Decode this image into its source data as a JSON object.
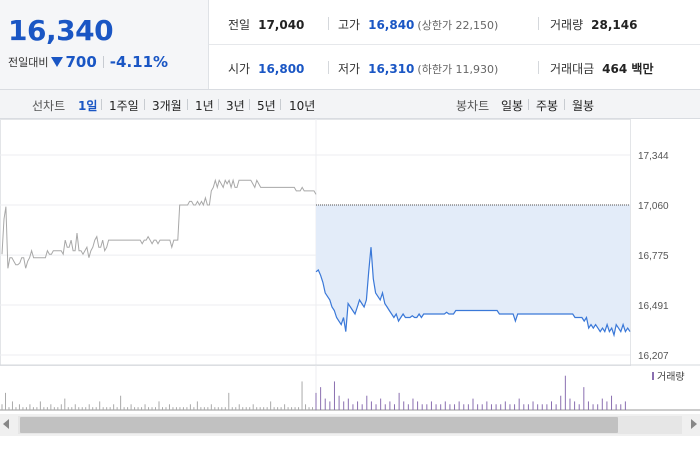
{
  "summary": {
    "price": "16,340",
    "change_label": "전일대비",
    "change_amount": "700",
    "change_percent": "-4.11%"
  },
  "stats": {
    "prev_close": {
      "label": "전일",
      "value": "17,040"
    },
    "high": {
      "label": "고가",
      "value": "16,840",
      "sub": "(상한가 22,150)"
    },
    "volume": {
      "label": "거래량",
      "value": "28,146"
    },
    "open": {
      "label": "시가",
      "value": "16,800"
    },
    "low": {
      "label": "저가",
      "value": "16,310",
      "sub": "(하한가 11,930)"
    },
    "trade_value": {
      "label": "거래대금",
      "value": "464 백만"
    }
  },
  "toolbar": {
    "line_label": "선차트",
    "line_periods": [
      "1일",
      "1주일",
      "3개월",
      "1년",
      "3년",
      "5년",
      "10년"
    ],
    "line_active": "1일",
    "candle_label": "봉차트",
    "candle_periods": [
      "일봉",
      "주봉",
      "월봉"
    ]
  },
  "colors": {
    "accent_blue": "#1a56c4",
    "line_blue": "#3a78d8",
    "prev_line_gray": "#a8a8a8",
    "area_fill": "#e3ecf9",
    "volume_bar": "#8a6fb0"
  },
  "icons": {
    "change_direction": "triangle-down-icon"
  },
  "chart_data": {
    "type": "line",
    "y_ticks": [
      "17,344",
      "17,060",
      "16,775",
      "16,491",
      "16,207"
    ],
    "y_tick_values": [
      17344,
      17060,
      16775,
      16491,
      16207
    ],
    "ylim": [
      16207,
      17344
    ],
    "reference_value": 17060,
    "volume_label": "거래량",
    "prev_day_series": [
      16780,
      16980,
      17050,
      16700,
      16760,
      16760,
      16740,
      16720,
      16720,
      16730,
      16760,
      16760,
      16700,
      16740,
      16760,
      16800,
      16760,
      16760,
      16760,
      16760,
      16760,
      16760,
      16760,
      16800,
      16780,
      16780,
      16800,
      16800,
      16800,
      16800,
      16800,
      16780,
      16860,
      16820,
      16820,
      16860,
      16800,
      16800,
      16900,
      16800,
      16800,
      16780,
      16800,
      16820,
      16760,
      16800,
      16820,
      16860,
      16880,
      16820,
      16820,
      16860,
      16800,
      16820,
      16860,
      16860,
      16860,
      16860,
      16860,
      16860,
      16860,
      16860,
      16860,
      16860,
      16860,
      16860,
      16860,
      16860,
      16860,
      16860,
      16860,
      16840,
      16860,
      16860,
      16880,
      16860,
      16840,
      16860,
      16860,
      16840,
      16860,
      16860,
      16860,
      16860,
      16860,
      16860,
      16820,
      16860,
      16860,
      16860,
      17060,
      17060,
      17060,
      17060,
      17060,
      17080,
      17080,
      17060,
      17060,
      17080,
      17060,
      17080,
      17060,
      17100,
      17060,
      17060,
      17140,
      17160,
      17200,
      17160,
      17200,
      17180,
      17160,
      17200,
      17180,
      17200,
      17160,
      17200,
      17160,
      17160,
      17200,
      17200,
      17200,
      17200,
      17200,
      17200,
      17200,
      17180,
      17160,
      17200,
      17180,
      17160,
      17160,
      17160,
      17160,
      17160,
      17160,
      17160,
      17160,
      17160,
      17160,
      17160,
      17160,
      17160,
      17160,
      17160,
      17160,
      17160,
      17160,
      17140,
      17140,
      17140,
      17160,
      17140,
      17140,
      17140,
      17140,
      17140,
      17140,
      17120
    ],
    "today_series": [
      16680,
      16690,
      16660,
      16620,
      16560,
      16540,
      16520,
      16480,
      16460,
      16420,
      16400,
      16380,
      16420,
      16340,
      16500,
      16480,
      16460,
      16440,
      16480,
      16520,
      16500,
      16480,
      16520,
      16680,
      16820,
      16640,
      16560,
      16540,
      16520,
      16560,
      16500,
      16480,
      16460,
      16440,
      16420,
      16440,
      16400,
      16420,
      16440,
      16420,
      16420,
      16420,
      16430,
      16420,
      16420,
      16440,
      16420,
      16440,
      16440,
      16440,
      16440,
      16440,
      16440,
      16440,
      16440,
      16440,
      16440,
      16450,
      16440,
      16440,
      16440,
      16460,
      16460,
      16460,
      16460,
      16460,
      16460,
      16460,
      16460,
      16460,
      16460,
      16460,
      16460,
      16460,
      16460,
      16460,
      16460,
      16460,
      16460,
      16460,
      16440,
      16440,
      16440,
      16440,
      16440,
      16440,
      16440,
      16400,
      16440,
      16440,
      16440,
      16440,
      16440,
      16440,
      16440,
      16440,
      16440,
      16440,
      16440,
      16440,
      16440,
      16440,
      16440,
      16440,
      16440,
      16440,
      16440,
      16440,
      16440,
      16440,
      16440,
      16440,
      16440,
      16420,
      16420,
      16420,
      16420,
      16400,
      16420,
      16360,
      16380,
      16360,
      16380,
      16360,
      16340,
      16360,
      16340,
      16380,
      16340,
      16360,
      16320,
      16380,
      16360,
      16340,
      16380,
      16340,
      16360,
      16340
    ],
    "volume_prev": [
      2,
      6,
      1,
      3,
      1,
      2,
      1,
      1,
      2,
      1,
      1,
      3,
      1,
      1,
      2,
      1,
      1,
      2,
      4,
      1,
      1,
      2,
      1,
      1,
      1,
      2,
      1,
      1,
      3,
      1,
      1,
      1,
      2,
      1,
      5,
      1,
      1,
      2,
      1,
      1,
      1,
      2,
      1,
      1,
      1,
      3,
      1,
      1,
      2,
      1,
      1,
      1,
      1,
      1,
      2,
      1,
      3,
      1,
      1,
      1,
      2,
      1,
      1,
      1,
      1,
      6,
      1,
      1,
      2,
      1,
      1,
      1,
      2,
      1,
      1,
      1,
      1,
      3,
      1,
      1,
      1,
      2,
      1,
      1,
      1,
      1,
      10,
      2,
      1,
      1
    ],
    "volume_today": [
      6,
      8,
      4,
      3,
      10,
      5,
      3,
      4,
      2,
      3,
      2,
      5,
      3,
      2,
      4,
      2,
      3,
      2,
      6,
      3,
      2,
      4,
      3,
      2,
      2,
      3,
      2,
      2,
      3,
      2,
      2,
      3,
      2,
      2,
      4,
      2,
      2,
      3,
      2,
      2,
      2,
      3,
      2,
      2,
      4,
      2,
      2,
      3,
      2,
      2,
      2,
      3,
      2,
      5,
      12,
      4,
      3,
      2,
      8,
      3,
      2,
      2,
      4,
      3,
      5,
      2,
      2,
      3
    ]
  }
}
